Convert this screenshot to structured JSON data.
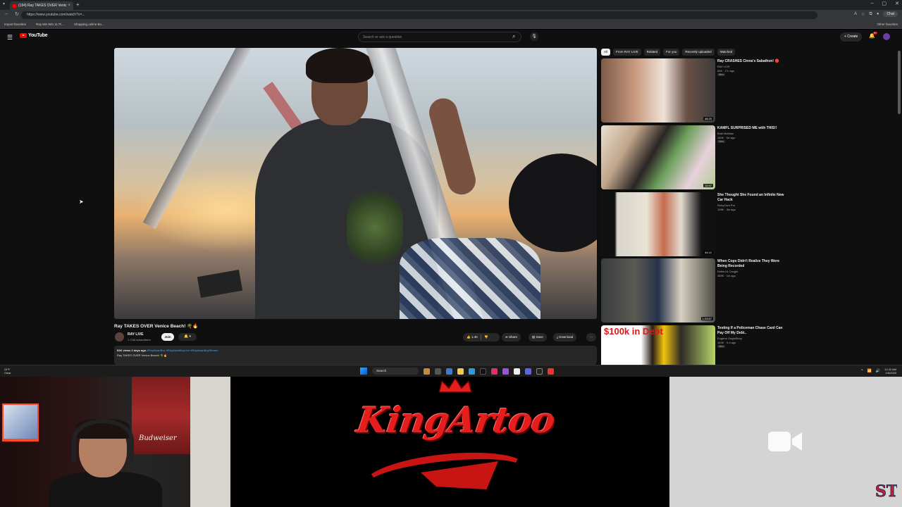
{
  "browser": {
    "tab_title": "(194) Ray TAKES OVER Venic",
    "url": "https://www.youtube.com/watch?v=...",
    "bookmarks": [
      "Import favorites",
      "Ray MS Win 11 Pi...",
      "Shopping online Bo..."
    ],
    "other_favorites": "Other favorites",
    "chat_label": "Chat"
  },
  "youtube": {
    "logo_text": "YouTube",
    "search_placeholder": "Search or ask a question",
    "create_label": "+ Create",
    "notif_count": "9+",
    "video": {
      "title": "Ray TAKES OVER Venice Beach! 🌴🔥",
      "channel": "RAY LIVE",
      "subscribers": "1.71M subscribers",
      "join_label": "Join",
      "like_count": "1.4K",
      "share_label": "Share",
      "save_label": "Save",
      "download_label": "Download",
      "desc_views": "51K views  2 days ago",
      "desc_tags": "#RayAsianBoy #RayAsianBoyLive #RayAsianBoyStream",
      "desc_line2": "Ray TAKES OVER Venice Beach! 🌴🔥"
    },
    "chips": [
      "All",
      "From RAY LIVE",
      "Related",
      "For you",
      "Recently uploaded",
      "Watched"
    ],
    "recommendations": [
      {
        "title": "Ray CRASHES Cinna's Sabathon! 🔴",
        "channel": "RAY LIVE",
        "meta": "84K · 2 h ago",
        "badge": "New",
        "duration": "48:20"
      },
      {
        "title": "KAMFL SURPRISED ME with THIS!!",
        "channel": "Bubl McMaw",
        "meta": "160K · 6d ago",
        "badge": "New",
        "duration": "10:47"
      },
      {
        "title": "She Thought She Found an Infinite New Car Hack",
        "channel": "RobyCam Pro",
        "meta": "108K · 3w ago",
        "badge": "",
        "duration": "44:12"
      },
      {
        "title": "When Cops Didn't Realize They Were Being Recorded",
        "channel": "Defied & Caught",
        "meta": "389K · 1w ago",
        "badge": "",
        "duration": "1:23:57"
      },
      {
        "title": "Testing If a Policeman Chase Card Can Pay Off My Debt..",
        "channel": "Eugene OnglaStory",
        "meta": "164K · 3 d ago",
        "badge": "New",
        "duration": "",
        "thumb_text": "$100k in Debt"
      }
    ]
  },
  "taskbar": {
    "weather_temp": "24°F",
    "weather_desc": "Clear",
    "search_label": "Search",
    "time": "12:42 AM",
    "date": "1/6/2025"
  },
  "overlay": {
    "flag_text": "Budweiser",
    "logo_text": "KingArtoo"
  }
}
